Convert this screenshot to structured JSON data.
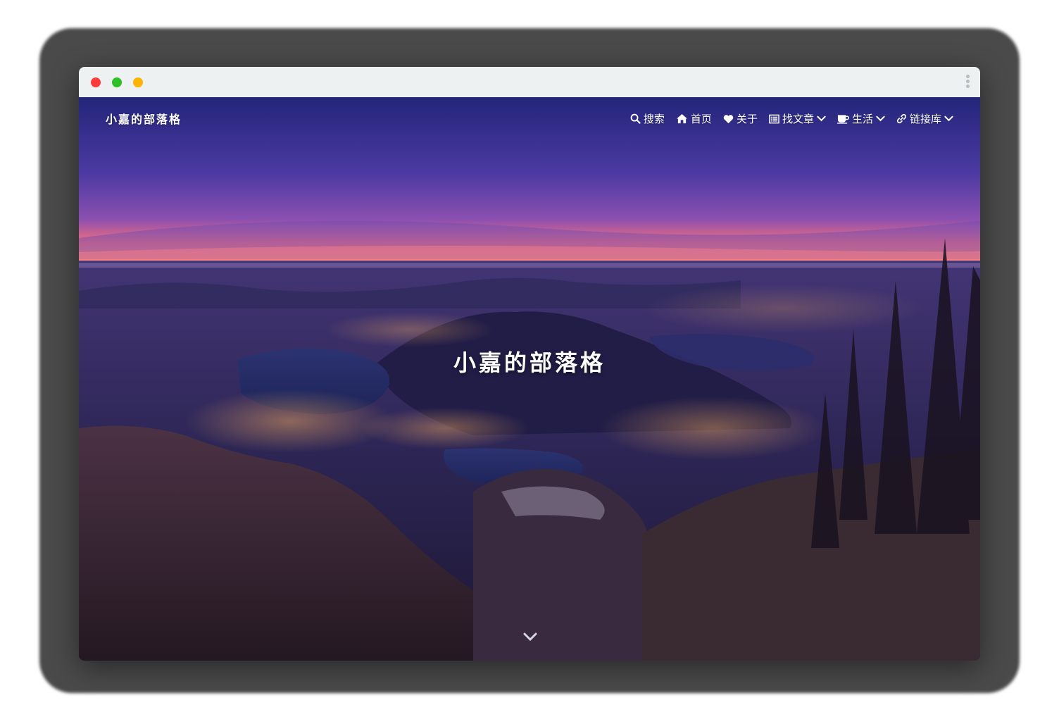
{
  "window": {
    "controls": {
      "close_color": "#fe3b3b",
      "minimize_color": "#2ec126",
      "maximize_color": "#fdb301"
    },
    "menu_icon": "kebab-menu-icon"
  },
  "site": {
    "brand": "小嘉的部落格",
    "title": "小嘉的部落格"
  },
  "nav": {
    "items": [
      {
        "label": "搜索",
        "icon": "search-icon",
        "has_dropdown": false
      },
      {
        "label": "首页",
        "icon": "home-icon",
        "has_dropdown": false
      },
      {
        "label": "关于",
        "icon": "heart-icon",
        "has_dropdown": false
      },
      {
        "label": "找文章",
        "icon": "list-icon",
        "has_dropdown": true
      },
      {
        "label": "生活",
        "icon": "coffee-icon",
        "has_dropdown": true
      },
      {
        "label": "链接库",
        "icon": "link-icon",
        "has_dropdown": true
      }
    ]
  },
  "hero": {
    "scroll_icon": "chevron-down-icon",
    "colors": {
      "sky_top": "#2b2c88",
      "sky_mid": "#5a3fa8",
      "horizon": "#ff7a6a",
      "ground": "#2a1f3d"
    }
  }
}
